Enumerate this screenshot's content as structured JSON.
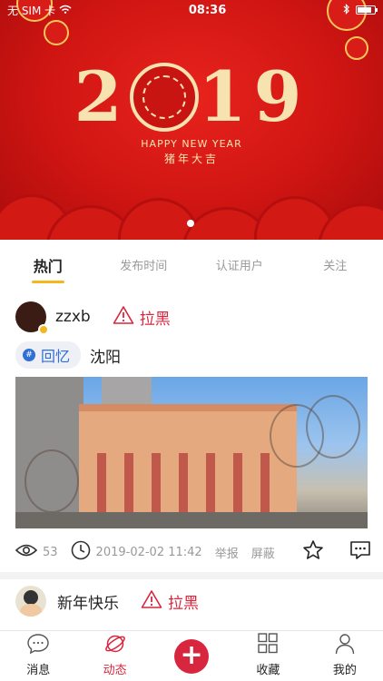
{
  "status_bar": {
    "carrier": "无 SIM 卡",
    "time": "08:36",
    "battery_level": 0.85
  },
  "banner": {
    "year_left": "2",
    "year_right": "19",
    "subtitle": "HAPPY NEW YEAR",
    "subtitle2": "猪年大吉",
    "colors": {
      "background": "#cf1512",
      "gold": "#f7e3b0"
    }
  },
  "tabs": [
    {
      "label": "热门",
      "active": true
    },
    {
      "label": "发布时间",
      "active": false
    },
    {
      "label": "认证用户",
      "active": false
    },
    {
      "label": "关注",
      "active": false
    }
  ],
  "post": {
    "username": "zzxb",
    "block_label": "拉黑",
    "topic": "回忆",
    "location": "沈阳",
    "views": "53",
    "date": "2019-02-02 11:42",
    "report_label": "举报",
    "hide_label": "屏蔽"
  },
  "post2": {
    "username": "新年快乐",
    "block_label": "拉黑"
  },
  "bottom_nav": {
    "items": [
      {
        "label": "消息",
        "icon": "chat-bubble-icon"
      },
      {
        "label": "动态",
        "icon": "planet-icon",
        "active": true
      },
      {
        "label": "",
        "icon": "plus-icon"
      },
      {
        "label": "收藏",
        "icon": "grid-icon"
      },
      {
        "label": "我的",
        "icon": "user-icon"
      }
    ]
  },
  "accent_color": "#d7263d",
  "tab_indicator_color": "#f3b81e"
}
